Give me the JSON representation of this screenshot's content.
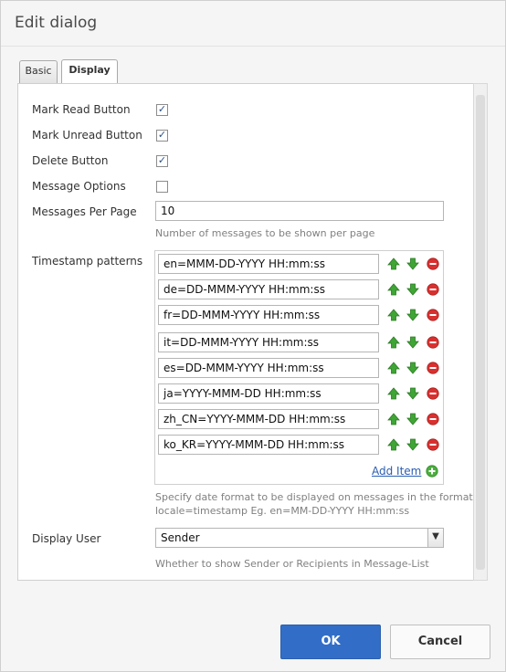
{
  "dialog": {
    "title": "Edit dialog"
  },
  "tabs": {
    "basic": "Basic",
    "display": "Display",
    "active": "Display"
  },
  "fields": {
    "mark_read": {
      "label": "Mark Read Button",
      "checked": true
    },
    "mark_unread": {
      "label": "Mark Unread Button",
      "checked": true
    },
    "delete": {
      "label": "Delete Button",
      "checked": true
    },
    "message_options": {
      "label": "Message Options",
      "checked": false
    },
    "messages_per_page": {
      "label": "Messages Per Page",
      "value": "10",
      "hint": "Number of messages to be shown per page"
    },
    "timestamp_patterns": {
      "label": "Timestamp patterns",
      "items": [
        "en=MMM-DD-YYYY HH:mm:ss",
        "de=DD-MMM-YYYY HH:mm:ss",
        "fr=DD-MMM-YYYY HH:mm:ss",
        "it=DD-MMM-YYYY HH:mm:ss",
        "es=DD-MMM-YYYY HH:mm:ss",
        "ja=YYYY-MMM-DD HH:mm:ss",
        "zh_CN=YYYY-MMM-DD HH:mm:ss",
        "ko_KR=YYYY-MMM-DD HH:mm:ss"
      ],
      "add_item": "Add Item",
      "hint_line1": "Specify date format to be displayed on messages in the format",
      "hint_line2": "locale=timestamp Eg. en=MM-DD-YYYY HH:mm:ss"
    },
    "display_user": {
      "label": "Display User",
      "value": "Sender",
      "hint": "Whether to show Sender or Recipients in Message-List"
    }
  },
  "buttons": {
    "ok": "OK",
    "cancel": "Cancel"
  },
  "colors": {
    "primary": "#326ec8",
    "arrow_green": "#3fa535",
    "remove_red": "#d9302f"
  },
  "check_mark": "✓"
}
